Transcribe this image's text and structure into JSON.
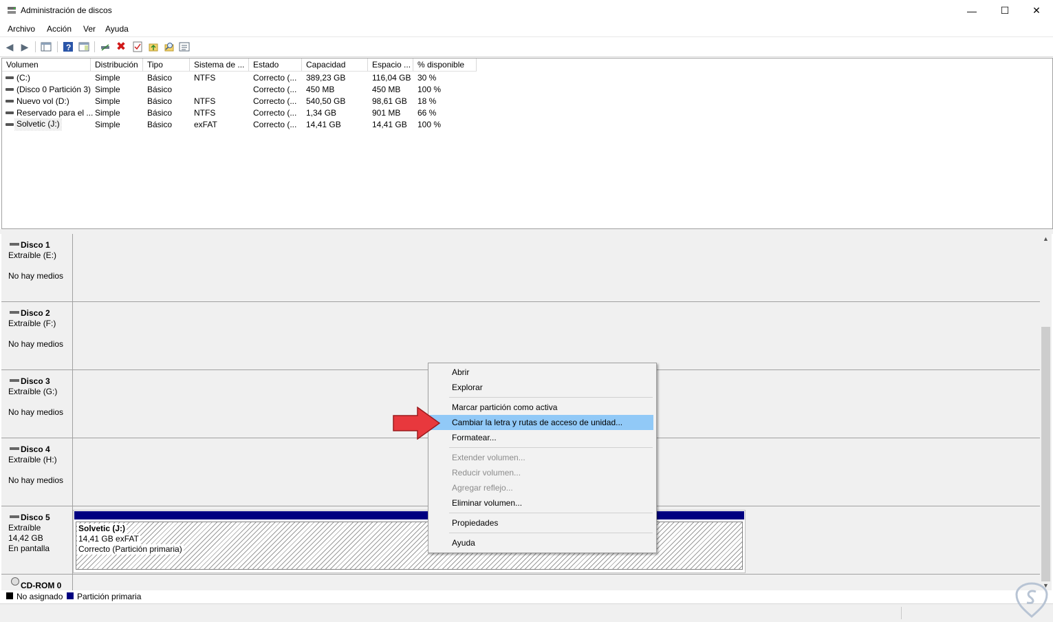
{
  "window": {
    "title": "Administración de discos"
  },
  "menu": [
    "Archivo",
    "Acción",
    "Ver",
    "Ayuda"
  ],
  "table": {
    "headers": [
      "Volumen",
      "Distribución",
      "Tipo",
      "Sistema de ...",
      "Estado",
      "Capacidad",
      "Espacio ...",
      "% disponible"
    ],
    "rows": [
      [
        "(C:)",
        "Simple",
        "Básico",
        "NTFS",
        "Correcto (...",
        "389,23 GB",
        "116,04 GB",
        "30 %"
      ],
      [
        "(Disco 0 Partición 3)",
        "Simple",
        "Básico",
        "",
        "Correcto (...",
        "450 MB",
        "450 MB",
        "100 %"
      ],
      [
        "Nuevo vol (D:)",
        "Simple",
        "Básico",
        "NTFS",
        "Correcto (...",
        "540,50 GB",
        "98,61 GB",
        "18 %"
      ],
      [
        "Reservado para el ...",
        "Simple",
        "Básico",
        "NTFS",
        "Correcto (...",
        "1,34 GB",
        "901 MB",
        "66 %"
      ],
      [
        "Solvetic (J:)",
        "Simple",
        "Básico",
        "exFAT",
        "Correcto (...",
        "14,41 GB",
        "14,41 GB",
        "100 %"
      ]
    ]
  },
  "disks": [
    {
      "name": "Disco 1",
      "type": "Extraíble (E:)",
      "status": "No hay medios"
    },
    {
      "name": "Disco 2",
      "type": "Extraíble (F:)",
      "status": "No hay medios"
    },
    {
      "name": "Disco 3",
      "type": "Extraíble (G:)",
      "status": "No hay medios"
    },
    {
      "name": "Disco 4",
      "type": "Extraíble (H:)",
      "status": "No hay medios"
    },
    {
      "name": "Disco 5",
      "type": "Extraíble",
      "size": "14,42 GB",
      "status": "En pantalla"
    },
    {
      "name": "CD-ROM 0"
    }
  ],
  "volume": {
    "name": "Solvetic  (J:)",
    "size": "14,41 GB exFAT",
    "status": "Correcto (Partición primaria)"
  },
  "legend": {
    "unallocated": "No asignado",
    "primary": "Partición primaria"
  },
  "context_menu": {
    "items": [
      "Abrir",
      "Explorar",
      "Marcar partición como activa",
      "Cambiar la letra y rutas de acceso de unidad...",
      "Formatear...",
      "Extender volumen...",
      "Reducir volumen...",
      "Agregar reflejo...",
      "Eliminar volumen...",
      "Propiedades",
      "Ayuda"
    ],
    "highlighted": "Cambiar la letra y rutas de acceso de unidad..."
  },
  "colors": {
    "primary_partition": "#000080",
    "highlight": "#91c9f7",
    "arrow": "#e8383d"
  }
}
